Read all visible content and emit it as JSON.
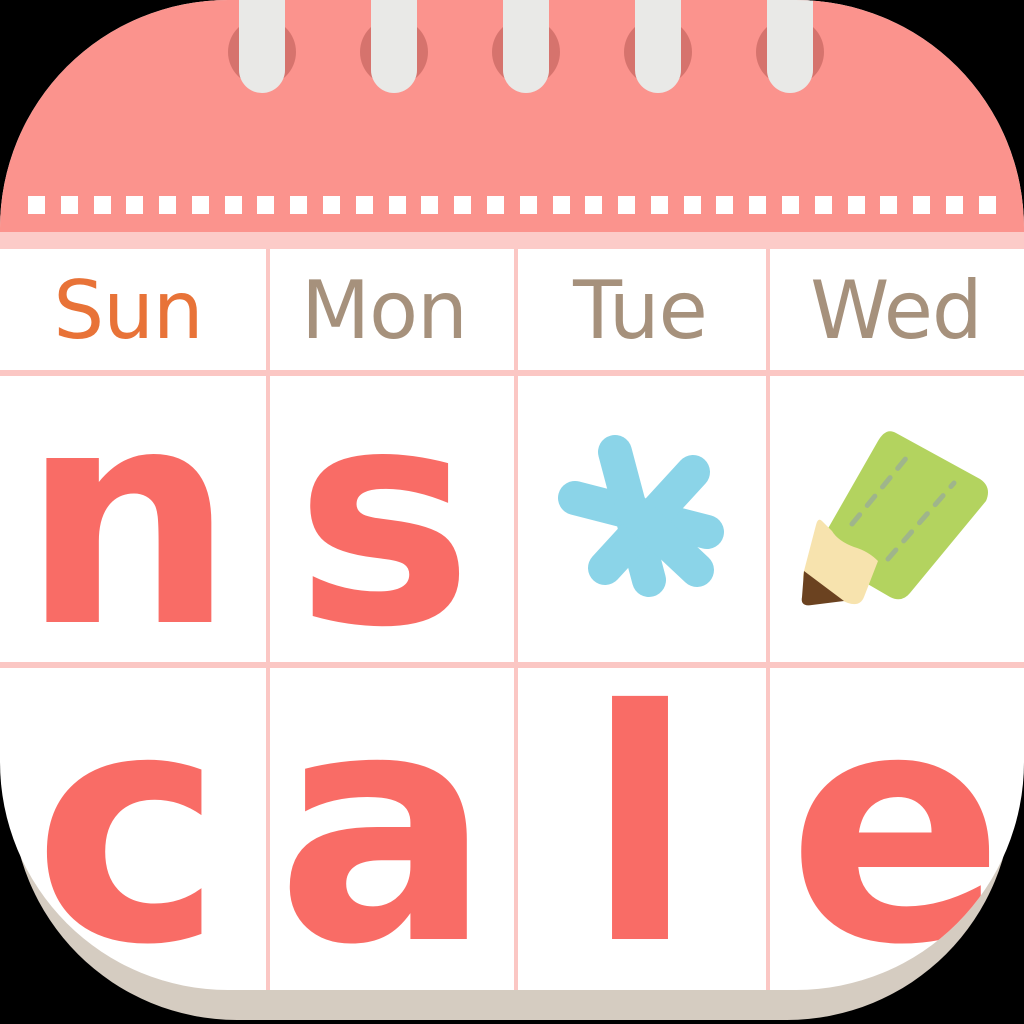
{
  "app": {
    "name": "ns*cale",
    "type": "calendar-app-icon"
  },
  "header": {
    "band_color": "#FB938D",
    "strip_color": "#FCCBC8",
    "ring_count": 5,
    "ring_color": "#E9E9E7",
    "ring_shadow_color": "#D6736D",
    "perforation_count": 30,
    "perforation_color": "#FFFFFF"
  },
  "daynames": {
    "items": [
      {
        "label": "Sun",
        "color": "#E87338",
        "kind": "sunday"
      },
      {
        "label": "Mon",
        "color": "#A6917C",
        "kind": "weekday"
      },
      {
        "label": "Tue",
        "color": "#A6917C",
        "kind": "weekday"
      },
      {
        "label": "Wed",
        "color": "#A6917C",
        "kind": "weekday"
      }
    ]
  },
  "grid": {
    "line_color": "#FBC7C4",
    "columns": 4,
    "rows": 3,
    "cell_background": "#FFFFFF"
  },
  "rows": {
    "row_1": [
      {
        "type": "letter",
        "text": "n"
      },
      {
        "type": "letter",
        "text": "s"
      },
      {
        "type": "icon",
        "text": "*",
        "icon": "asterisk-icon",
        "color": "#8BD4E8"
      },
      {
        "type": "icon",
        "text": "",
        "icon": "pencil-icon",
        "color": "#B3D35F"
      }
    ],
    "row_2": [
      {
        "type": "letter",
        "text": "c"
      },
      {
        "type": "letter",
        "text": "a"
      },
      {
        "type": "letter",
        "text": "l"
      },
      {
        "type": "letter",
        "text": "e"
      }
    ]
  },
  "colors": {
    "letter": "#F96C66",
    "salmon": "#FB938D",
    "light_pink": "#FCCBC8",
    "grid_pink": "#FBC7C4",
    "orange": "#E87338",
    "taupe": "#A6917C",
    "sky_blue": "#8BD4E8",
    "pencil_green": "#B3D35F",
    "pencil_wood": "#F7E3AE",
    "pencil_lead": "#6B4220",
    "card_shadow": "#D5CCC1",
    "white": "#FFFFFF"
  }
}
